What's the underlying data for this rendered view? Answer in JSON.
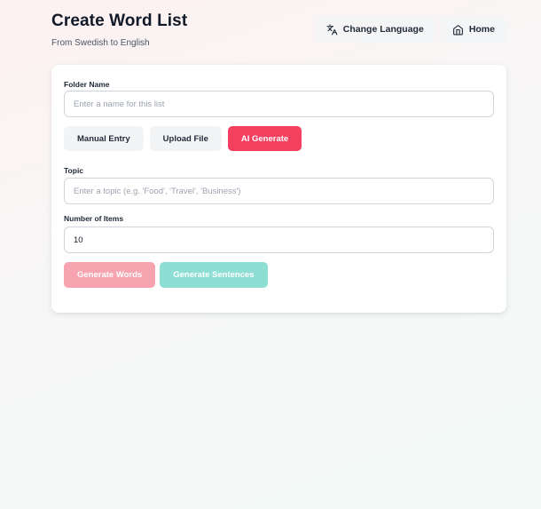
{
  "header": {
    "title": "Create Word List",
    "subtitle": "From Swedish to English"
  },
  "header_actions": {
    "change_language_label": "Change Language",
    "home_label": "Home"
  },
  "form": {
    "folder_name": {
      "label": "Folder Name",
      "value": "",
      "placeholder": "Enter a name for this list"
    },
    "tabs": [
      {
        "label": "Manual Entry",
        "active": false
      },
      {
        "label": "Upload File",
        "active": false
      },
      {
        "label": "AI Generate",
        "active": true
      }
    ],
    "topic": {
      "label": "Topic",
      "value": "",
      "placeholder": "Enter a topic (e.g. 'Food', 'Travel', 'Business')"
    },
    "number_of_items": {
      "label": "Number of Items",
      "value": "10"
    },
    "generate_words_label": "Generate Words",
    "generate_sentences_label": "Generate Sentences"
  },
  "colors": {
    "accent": "#f43f5e",
    "accent_disabled": "#f7a3b0",
    "teal_disabled": "#8ddfd4"
  },
  "icons": {
    "change_language": "translate-icon",
    "home": "home-icon"
  }
}
